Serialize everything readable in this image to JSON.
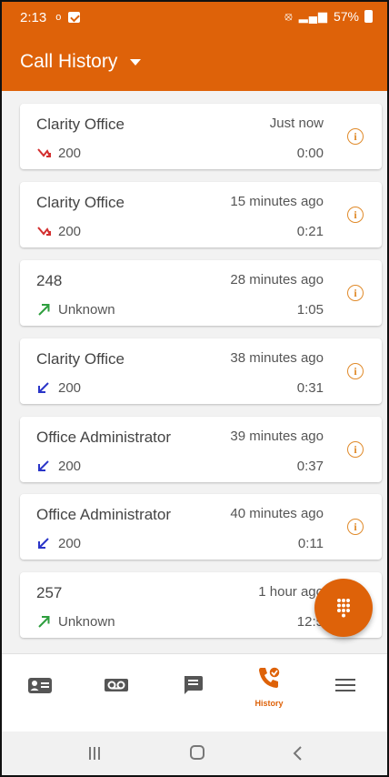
{
  "status_bar": {
    "time": "2:13",
    "dot": "o",
    "battery_percent": "57%"
  },
  "app_bar": {
    "title": "Call History"
  },
  "calls": [
    {
      "name": "Clarity Office",
      "when": "Just now",
      "number": "200",
      "duration": "0:00",
      "direction": "missed"
    },
    {
      "name": "Clarity Office",
      "when": "15 minutes ago",
      "number": "200",
      "duration": "0:21",
      "direction": "missed"
    },
    {
      "name": "248",
      "when": "28 minutes ago",
      "number": "Unknown",
      "duration": "1:05",
      "direction": "outgoing"
    },
    {
      "name": "Clarity Office",
      "when": "38 minutes ago",
      "number": "200",
      "duration": "0:31",
      "direction": "incoming"
    },
    {
      "name": "Office Administrator",
      "when": "39 minutes ago",
      "number": "200",
      "duration": "0:37",
      "direction": "incoming"
    },
    {
      "name": "Office Administrator",
      "when": "40 minutes ago",
      "number": "200",
      "duration": "0:11",
      "direction": "incoming"
    },
    {
      "name": "257",
      "when": "1 hour ago",
      "number": "Unknown",
      "duration": "12:5",
      "direction": "outgoing"
    }
  ],
  "bottom_nav": [
    {
      "icon": "contacts-icon",
      "label": ""
    },
    {
      "icon": "voicemail-icon",
      "label": ""
    },
    {
      "icon": "chat-icon",
      "label": ""
    },
    {
      "icon": "history-icon",
      "label": "History",
      "active": true
    },
    {
      "icon": "menu-icon",
      "label": ""
    }
  ],
  "colors": {
    "accent": "#de6209",
    "missed": "#d32f2f",
    "outgoing": "#2e9e3e",
    "incoming": "#2a35c8",
    "info": "#e08a2a"
  }
}
